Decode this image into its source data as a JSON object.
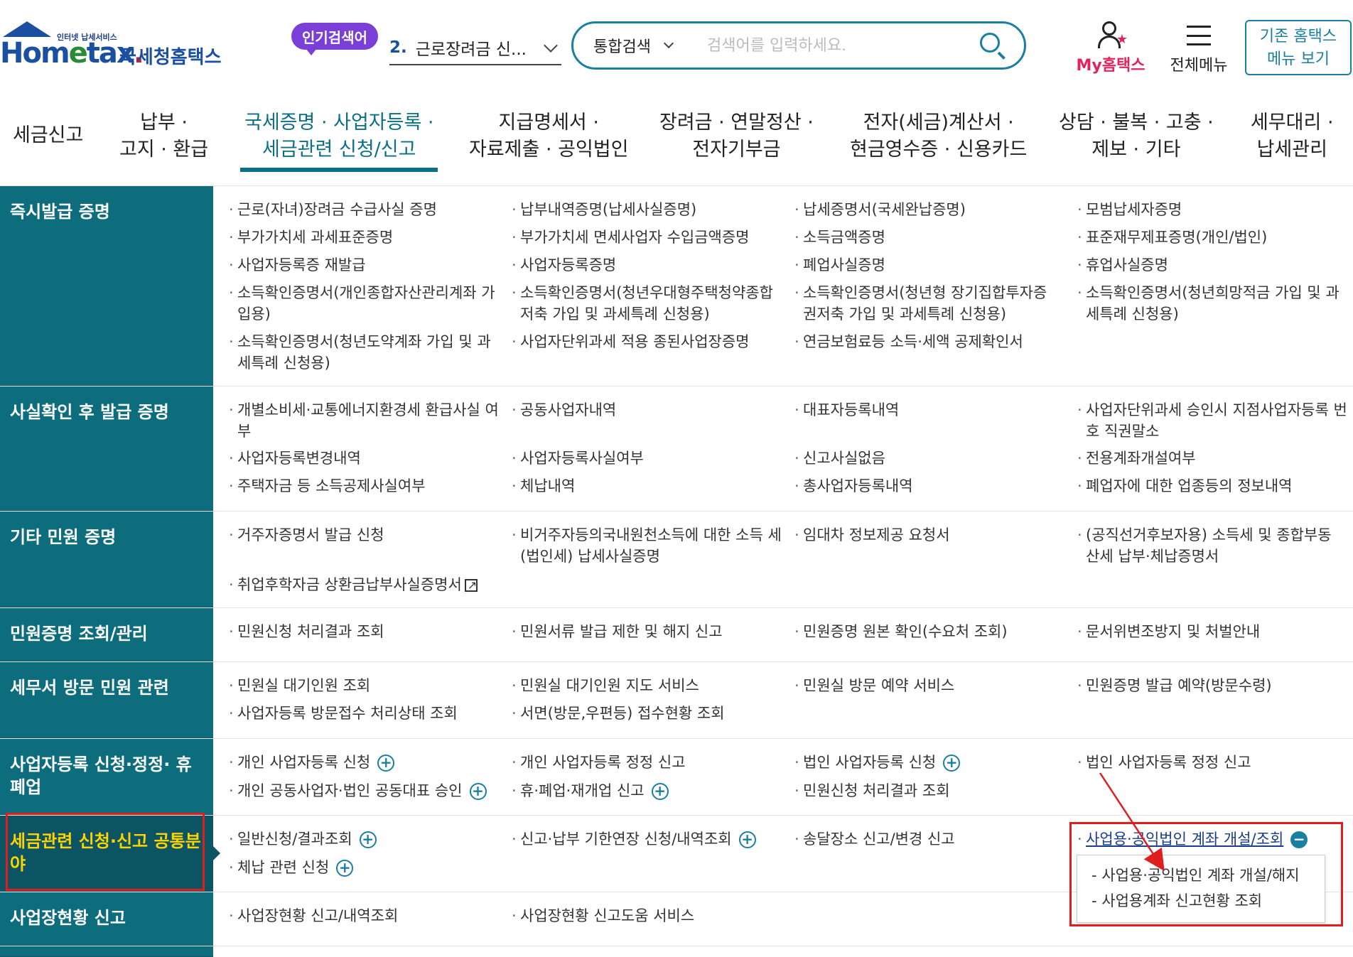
{
  "header": {
    "logo_small": "인터넷 납세서비스",
    "logo_en_1": "Hom",
    "logo_en_e": "e",
    "logo_en_2": "tax",
    "logo_en_dot": ".",
    "logo_kr": "국세청홈택스",
    "popular_badge": "인기검색어",
    "popular_num": "2.",
    "popular_text": "근로장려금 신...",
    "search_scope": "통합검색",
    "search_placeholder": "검색어를 입력하세요.",
    "my_hometax": "My홈택스",
    "all_menu": "전체메뉴",
    "old_menu_1": "기존 홈택스",
    "old_menu_2": "메뉴 보기"
  },
  "gnb": [
    {
      "l1": "세금신고",
      "l2": ""
    },
    {
      "l1": "납부 ·",
      "l2": "고지 · 환급"
    },
    {
      "l1": "국세증명 · 사업자등록 ·",
      "l2": "세금관련 신청/신고"
    },
    {
      "l1": "지급명세서 ·",
      "l2": "자료제출 · 공익법인"
    },
    {
      "l1": "장려금 · 연말정산 ·",
      "l2": "전자기부금"
    },
    {
      "l1": "전자(세금)계산서 ·",
      "l2": "현금영수증 · 신용카드"
    },
    {
      "l1": "상담 · 불복 · 고충 ·",
      "l2": "제보 · 기타"
    },
    {
      "l1": "세무대리 ·",
      "l2": "납세관리"
    }
  ],
  "rows": [
    {
      "cat": "즉시발급 증명",
      "items": [
        "근로(자녀)장려금 수급사실 증명",
        "납부내역증명(납세사실증명)",
        "납세증명서(국세완납증명)",
        "모범납세자증명",
        "부가가치세 과세표준증명",
        "부가가치세 면세사업자 수입금액증명",
        "소득금액증명",
        "표준재무제표증명(개인/법인)",
        "사업자등록증 재발급",
        "사업자등록증명",
        "폐업사실증명",
        "휴업사실증명",
        "소득확인증명서(개인종합자산관리계좌 가입용)",
        "소득확인증명서(청년우대형주택청약종합 저축 가입 및 과세특례 신청용)",
        "소득확인증명서(청년형 장기집합투자증 권저축 가입 및 과세특례 신청용)",
        "소득확인증명서(청년희망적금 가입 및 과 세특례 신청용)",
        "소득확인증명서(청년도약계좌 가입 및 과 세특례 신청용)",
        "사업자단위과세 적용 종된사업장증명",
        "연금보험료등 소득·세액 공제확인서",
        ""
      ]
    },
    {
      "cat": "사실확인 후 발급 증명",
      "items": [
        "개별소비세·교통에너지환경세 환급사실 여부",
        "공동사업자내역",
        "대표자등록내역",
        "사업자단위과세 승인시 지점사업자등록 번호 직권말소",
        "사업자등록변경내역",
        "사업자등록사실여부",
        "신고사실없음",
        "전용계좌개설여부",
        "주택자금 등 소득공제사실여부",
        "체납내역",
        "총사업자등록내역",
        "폐업자에 대한 업종등의 정보내역"
      ]
    },
    {
      "cat": "기타 민원 증명",
      "items": [
        "거주자증명서 발급 신청",
        "비거주자등의국내원천소득에 대한 소득 세(법인세) 납세사실증명",
        "임대차 정보제공 요청서",
        "(공직선거후보자용) 소득세 및 종합부동 산세 납부·체납증명서",
        "취업후학자금 상환금납부사실증명서"
      ]
    },
    {
      "cat": "민원증명 조회/관리",
      "items": [
        "민원신청 처리결과 조회",
        "민원서류 발급 제한 및 해지 신고",
        "민원증명 원본 확인(수요처 조회)",
        "문서위변조방지 및 처벌안내"
      ]
    },
    {
      "cat": "세무서 방문 민원 관련",
      "items": [
        "민원실 대기인원 조회",
        "민원실 대기인원 지도 서비스",
        "민원실 방문 예약 서비스",
        "민원증명 발급 예약(방문수령)",
        "사업자등록 방문접수 처리상태 조회",
        "서면(방문,우편등) 접수현황 조회"
      ]
    },
    {
      "cat": "사업자등록 신청·정정· 휴폐업",
      "items": [
        "개인 사업자등록 신청",
        "개인 사업자등록 정정 신고",
        "법인 사업자등록 신청",
        "법인 사업자등록 정정 신고",
        "개인 공동사업자·법인 공동대표 승인",
        "휴·폐업·재개업 신고",
        "민원신청 처리결과 조회"
      ]
    },
    {
      "cat": "세금관련 신청·신고 공통분야",
      "items": [
        "일반신청/결과조회",
        "신고·납부 기한연장 신청/내역조회",
        "송달장소 신고/변경 신고",
        "사업용·공익법인 계좌 개설/조회",
        "체납 관련 신청"
      ]
    },
    {
      "cat": "사업장현황 신고",
      "items": [
        "사업장현황 신고/내역조회",
        "사업장현황 신고도움 서비스"
      ]
    }
  ],
  "submenu": [
    "- 사업용·공익법인 계좌 개설/해지",
    "- 사업용계좌 신고현황 조회"
  ],
  "colors": {
    "category_bg": "#0d6d7d",
    "active_category_text": "#ffd200",
    "accent": "#1a7fa0",
    "annotation": "#e01e1e"
  }
}
